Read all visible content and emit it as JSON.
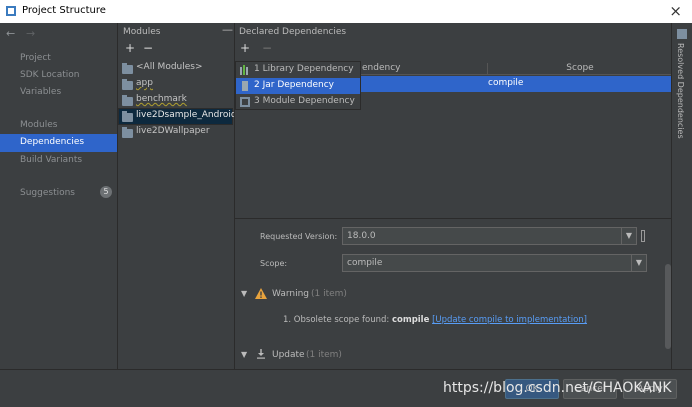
{
  "window": {
    "title": "Project Structure",
    "close": "×"
  },
  "nav": {
    "back": "←",
    "forward": "→",
    "items": [
      "Project",
      "SDK Location",
      "Variables",
      "Modules",
      "Dependencies",
      "Build Variants",
      "Suggestions"
    ],
    "suggestions_count": "5"
  },
  "modules": {
    "title": "Modules",
    "add": "+",
    "remove": "−",
    "collapse": "—",
    "items": [
      "<All Modules>",
      "app",
      "benchmark",
      "live2Dsample_Android",
      "live2DWallpaper"
    ]
  },
  "declared": {
    "title": "Declared Dependencies",
    "add": "+",
    "remove": "−",
    "col_dependency": "endency",
    "col_scope": "Scope",
    "selected_scope": "compile",
    "popup": [
      "1  Library Dependency",
      "2  Jar Dependency",
      "3  Module Dependency"
    ]
  },
  "details": {
    "requested_version_label": "Requested Version:",
    "requested_version": "18.0.0",
    "scope_label": "Scope:",
    "scope": "compile",
    "warning_title": "Warning",
    "warning_count": "(1 item)",
    "warning_text": "1. Obsolete scope found:",
    "warning_bold": "compile",
    "warning_link": "[Update compile to implementation]",
    "update_title": "Update",
    "update_count": "(1 item)"
  },
  "right_strip": {
    "label": "Resolved Dependencies"
  },
  "bottom": {
    "ok": "OK",
    "cancel": "Cancel",
    "apply": "Apply"
  },
  "watermark": "https://blog.csdn.net/CHAOKANK"
}
